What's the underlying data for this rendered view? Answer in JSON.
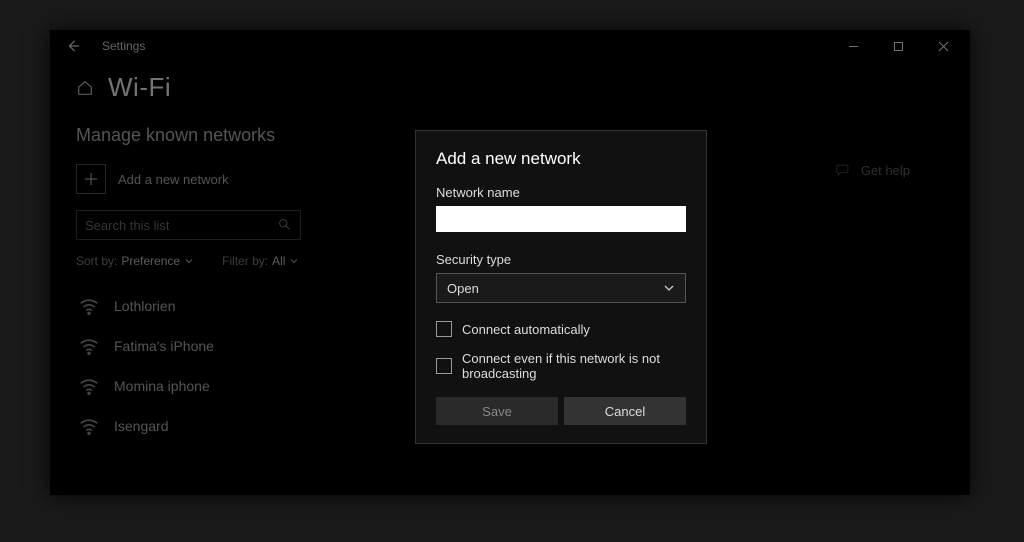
{
  "titlebar": {
    "title": "Settings"
  },
  "page": {
    "title": "Wi-Fi",
    "section_title": "Manage known networks",
    "add_label": "Add a new network",
    "search_placeholder": "Search this list"
  },
  "filters": {
    "sort_label": "Sort by:",
    "sort_value": "Preference",
    "filter_label": "Filter by:",
    "filter_value": "All"
  },
  "networks": [
    {
      "name": "Lothlorien"
    },
    {
      "name": "Fatima's iPhone"
    },
    {
      "name": "Momina iphone"
    },
    {
      "name": "Isengard"
    }
  ],
  "help": {
    "label": "Get help"
  },
  "dialog": {
    "title": "Add a new network",
    "name_label": "Network name",
    "name_value": "",
    "security_label": "Security type",
    "security_value": "Open",
    "connect_auto": "Connect automatically",
    "connect_hidden": "Connect even if this network is not broadcasting",
    "save": "Save",
    "cancel": "Cancel"
  }
}
